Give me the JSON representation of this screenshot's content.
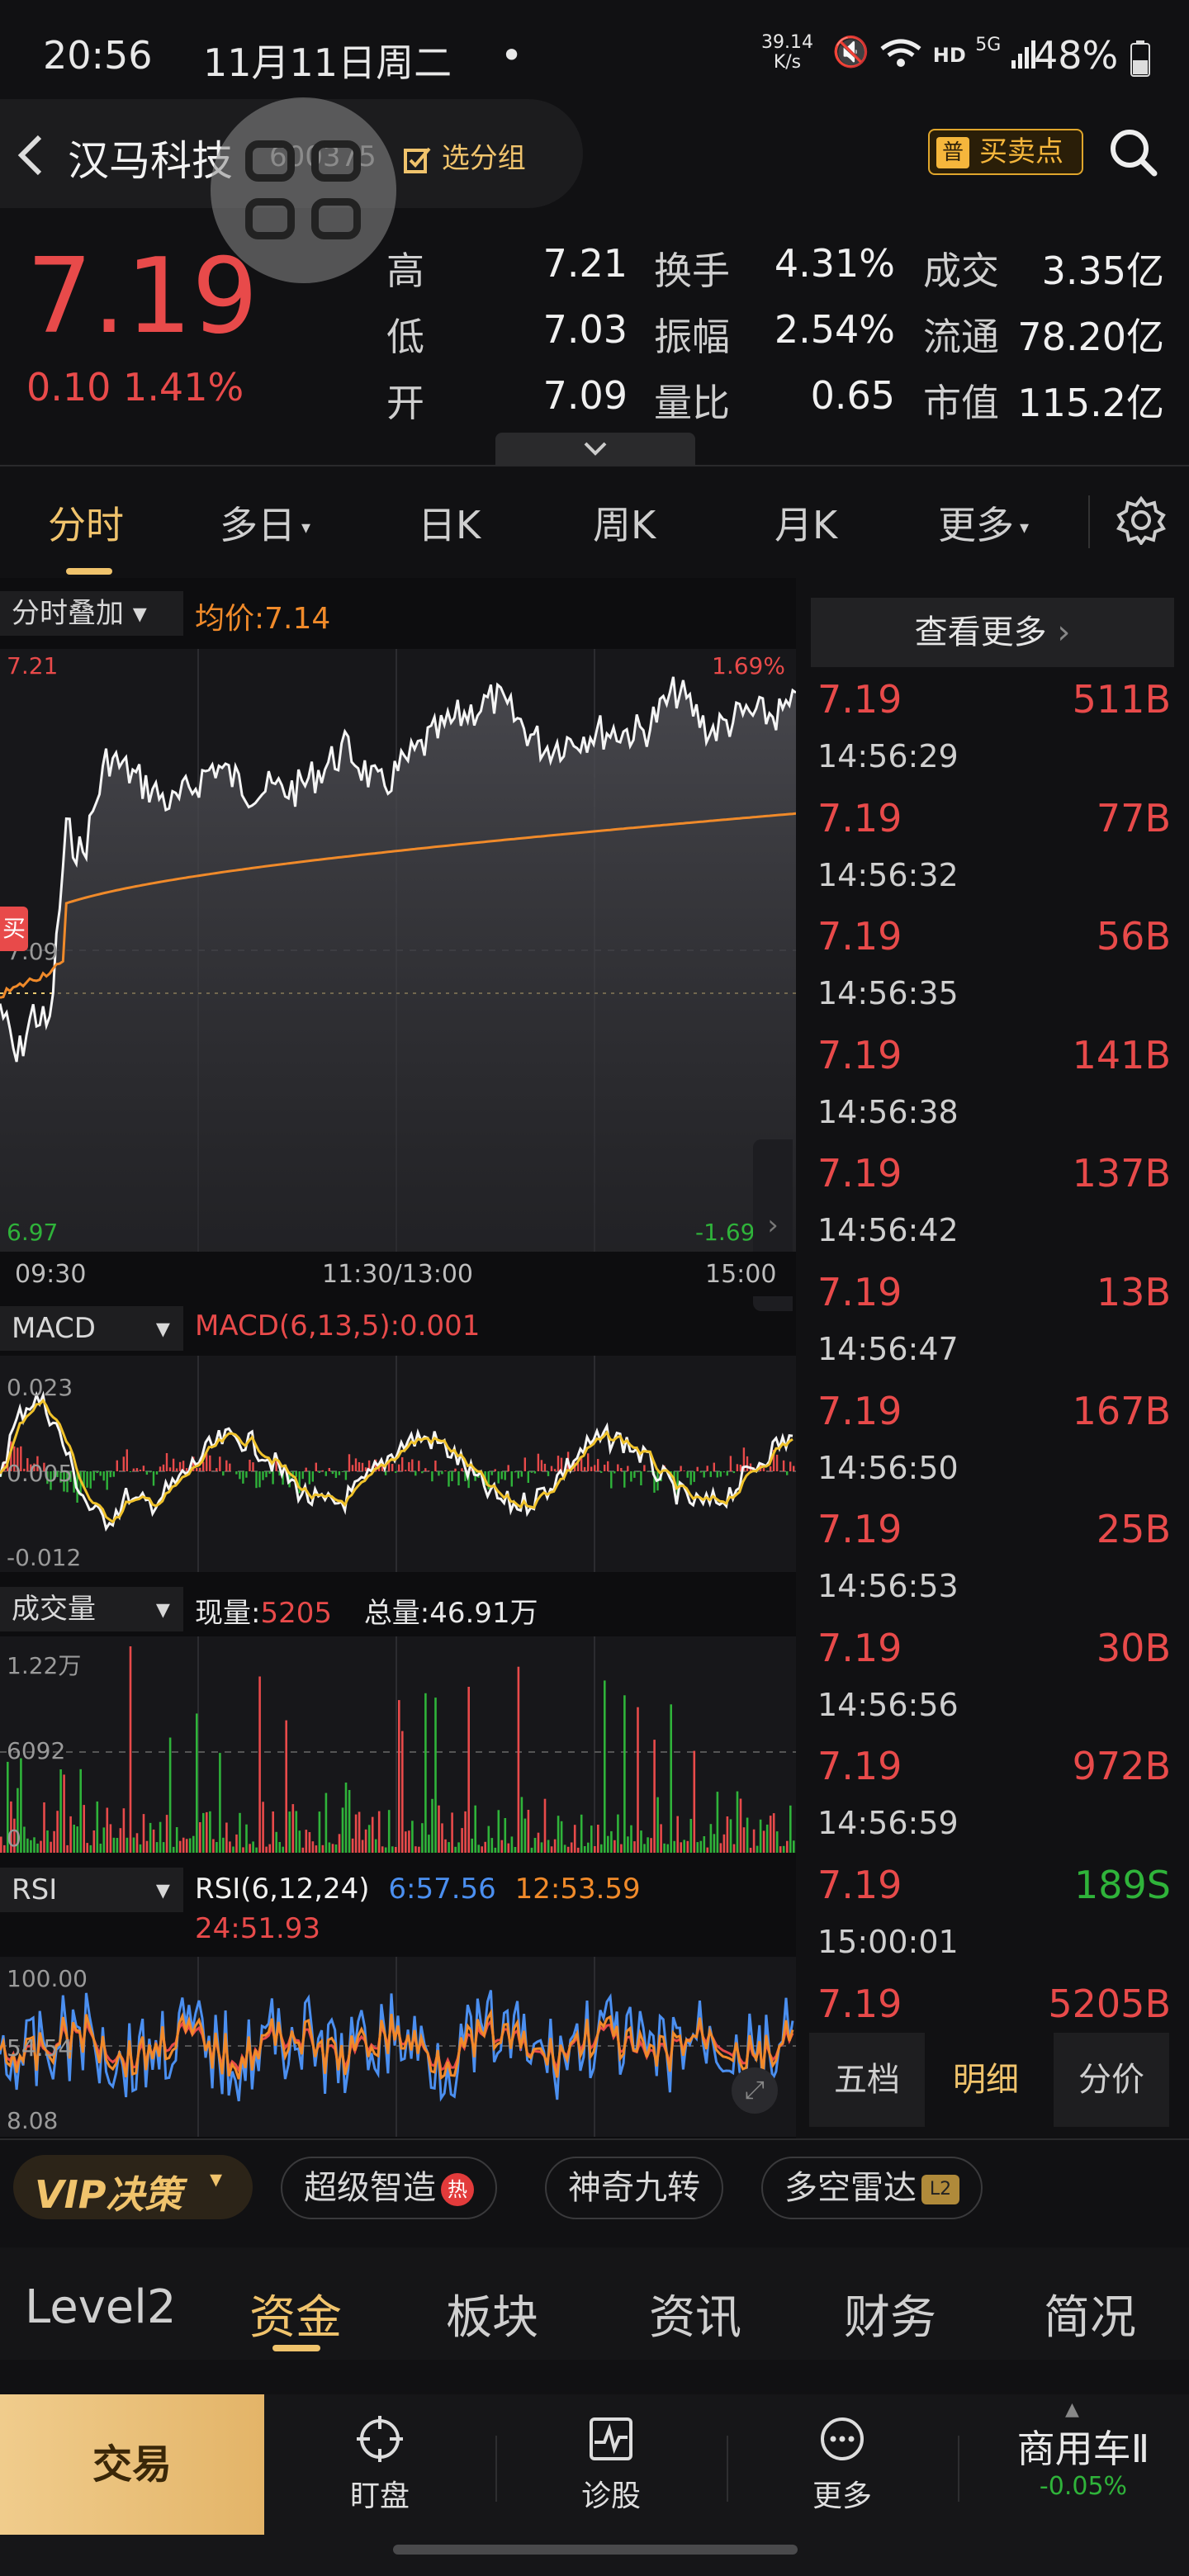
{
  "status_bar": {
    "time": "20:56",
    "date": "11月11日周二",
    "dot": "•",
    "net_speed_value": "39.14",
    "net_speed_unit": "K/s",
    "hd": "HD",
    "fiveg": "5G",
    "battery": "48%"
  },
  "header": {
    "back_icon": "chevron-left-icon",
    "name": "汉马科技",
    "code": "600375",
    "add_group": "选分组",
    "buysell_badge": "普",
    "buysell": "买卖点",
    "search_icon": "search-icon"
  },
  "quote": {
    "last": "7.19",
    "change": "0.10",
    "change_pct": "1.41%",
    "stats": [
      {
        "label": "高",
        "value": "7.21",
        "color": "#e84a4a"
      },
      {
        "label": "低",
        "value": "7.03",
        "color": "#2fb33a"
      },
      {
        "label": "开",
        "value": "7.09",
        "color": "#f0f0f0"
      },
      {
        "label": "换手",
        "value": "4.31%"
      },
      {
        "label": "振幅",
        "value": "2.54%"
      },
      {
        "label": "量比",
        "value": "0.65"
      },
      {
        "label": "成交",
        "value": "3.35亿"
      },
      {
        "label": "流通",
        "value": "78.20亿"
      },
      {
        "label": "市值",
        "value": "115.2亿"
      }
    ],
    "expand_icon": "chevron-down-icon"
  },
  "chart_tabs": [
    "分时",
    "多日",
    "日K",
    "周K",
    "月K",
    "更多"
  ],
  "intraday": {
    "overlay_label": "分时叠加",
    "avg_label": "均价:",
    "avg_value": "7.14",
    "y_top": "7.21",
    "y_bottom": "6.97",
    "y_top_pct": "1.69%",
    "y_bottom_pct": "-1.69%",
    "y_mid": "7.09",
    "buy_marker": "买",
    "time_start": "09:30",
    "time_mid": "11:30/13:00",
    "time_end": "15:00"
  },
  "macd": {
    "label": "MACD",
    "params": "MACD(6,13,5):0.001",
    "y_top": "0.023",
    "y_mid": "0.005",
    "y_bottom": "-0.012"
  },
  "volume": {
    "label": "成交量",
    "cur_label": "现量:",
    "cur_value": "5205",
    "total_label": "总量:46.91万",
    "y_top": "1.22万",
    "y_mid": "6092",
    "y_bottom": "0"
  },
  "rsi": {
    "label": "RSI",
    "params": "RSI(6,12,24)",
    "r6": "6:57.56",
    "r12": "12:53.59",
    "r24": "24:51.93",
    "y_top": "100.00",
    "y_mid": "54.54",
    "y_bottom": "8.08"
  },
  "trades": {
    "view_more": "查看更多",
    "rows": [
      {
        "price": "7.19",
        "vol": "511B",
        "side": "buy",
        "time": "14:56:29"
      },
      {
        "price": "7.19",
        "vol": "77B",
        "side": "buy",
        "time": "14:56:32"
      },
      {
        "price": "7.19",
        "vol": "56B",
        "side": "buy",
        "time": "14:56:35"
      },
      {
        "price": "7.19",
        "vol": "141B",
        "side": "buy",
        "time": "14:56:38"
      },
      {
        "price": "7.19",
        "vol": "137B",
        "side": "buy",
        "time": "14:56:42"
      },
      {
        "price": "7.19",
        "vol": "13B",
        "side": "buy",
        "time": "14:56:47"
      },
      {
        "price": "7.19",
        "vol": "167B",
        "side": "buy",
        "time": "14:56:50"
      },
      {
        "price": "7.19",
        "vol": "25B",
        "side": "buy",
        "time": "14:56:53"
      },
      {
        "price": "7.19",
        "vol": "30B",
        "side": "buy",
        "time": "14:56:56"
      },
      {
        "price": "7.19",
        "vol": "972B",
        "side": "buy",
        "time": "14:56:59"
      },
      {
        "price": "7.19",
        "vol": "189S",
        "side": "sell",
        "time": "15:00:01"
      },
      {
        "price": "7.19",
        "vol": "5205B",
        "side": "buy",
        "time": ""
      }
    ],
    "tabs": [
      "五档",
      "明细",
      "分价"
    ]
  },
  "tools": {
    "vip": "VIP决策",
    "items": [
      "超级智造",
      "神奇九转",
      "多空雷达"
    ],
    "hot_badge": "热",
    "l2_badge": "L2"
  },
  "sections": [
    "Level2",
    "资金",
    "板块",
    "资讯",
    "财务",
    "简况"
  ],
  "nav": {
    "trade": "交易",
    "items": [
      {
        "label": "盯盘",
        "icon": "crosshair-icon"
      },
      {
        "label": "诊股",
        "icon": "pulse-chart-icon"
      },
      {
        "label": "更多",
        "icon": "more-dots-icon"
      }
    ],
    "sector_name": "商用车Ⅱ",
    "sector_change": "-0.05%"
  }
}
